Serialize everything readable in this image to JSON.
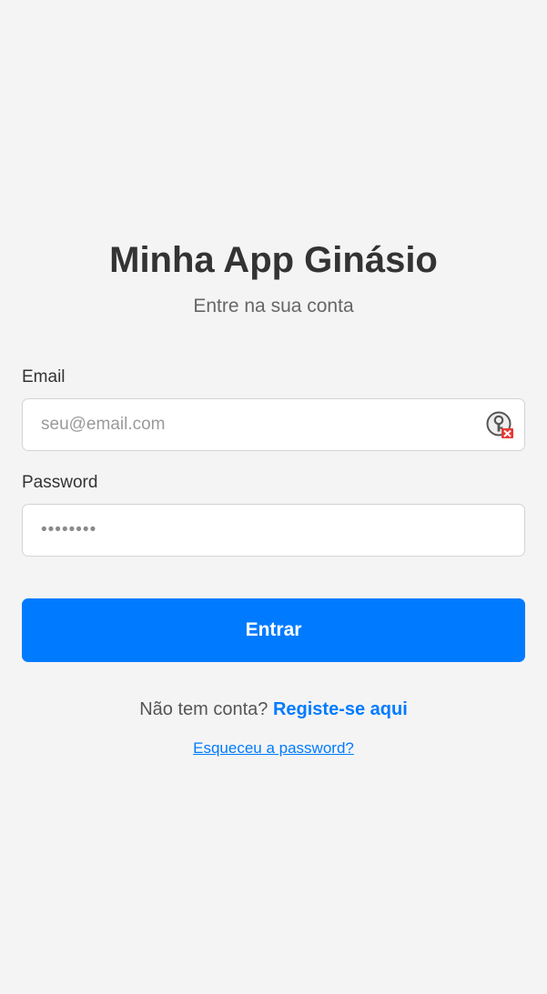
{
  "header": {
    "title": "Minha App Ginásio",
    "subtitle": "Entre na sua conta"
  },
  "form": {
    "email": {
      "label": "Email",
      "placeholder": "seu@email.com",
      "value": ""
    },
    "password": {
      "label": "Password",
      "placeholder": "••••••••",
      "value": ""
    },
    "submit_label": "Entrar"
  },
  "footer": {
    "no_account_text": "Não tem conta?",
    "register_link": "Registe-se aqui",
    "forgot_link": "Esqueceu a password?"
  },
  "colors": {
    "background": "#f4f4f4",
    "primary": "#007bff",
    "password_manager_badge": "#e53935"
  },
  "icons": {
    "email_field_icon": "password-manager-icon"
  }
}
